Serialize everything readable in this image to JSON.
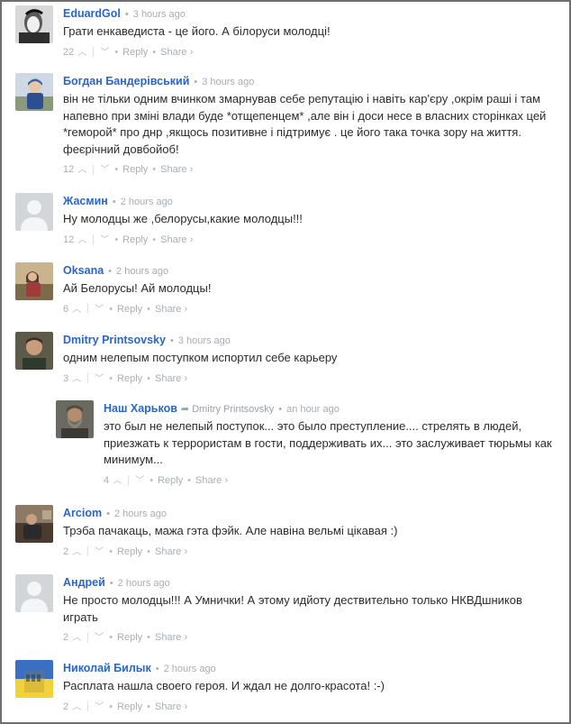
{
  "labels": {
    "reply": "Reply",
    "share": "Share ›",
    "separator": "•"
  },
  "comments": [
    {
      "author": "EduardGol",
      "time": "3 hours ago",
      "text": "Грати енкаведиста - це його. А білоруси молодці!",
      "votes": "22",
      "avatar": "bw-face-icon"
    },
    {
      "author": "Богдан Бандерівський",
      "time": "3 hours ago",
      "text": "він не тільки одним вчинком змарнував себе репутацію і навіть кар'єру ,окрім раші і там напевно при зміні влади буде *отщепенцем* ,але він і доси несе в власних сторінках цей *геморой* про днр ,якщось позитивне і підтримує . це його така точка зору на життя. феєрічний довбойоб!",
      "votes": "12",
      "avatar": "child-photo-icon"
    },
    {
      "author": "Жасмин",
      "time": "2 hours ago",
      "text": "Ну молодцы же ,белорусы,какие молодцы!!!",
      "votes": "12",
      "avatar": "default-user-icon"
    },
    {
      "author": "Oksana",
      "time": "2 hours ago",
      "text": "Ай Белорусы! Ай молодцы!",
      "votes": "6",
      "avatar": "woman-photo-icon"
    },
    {
      "author": "Dmitry Printsovsky",
      "time": "3 hours ago",
      "text": "одним нелепым поступком испортил себе карьеру",
      "votes": "3",
      "avatar": "man-photo-icon"
    },
    {
      "author": "Наш Харьков",
      "reply_to": "Dmitry Printsovsky",
      "time": "an hour ago",
      "text": "это был не нелепый поступок... это было преступление.... стрелять в людей, приезжать к террористам в гости, поддерживать их... это заслуживает тюрьмы как минимум...",
      "votes": "4",
      "avatar": "bearded-man-icon"
    },
    {
      "author": "Arciom",
      "time": "2 hours ago",
      "text": "Трэба пачакаць, мажа гэта фэйк. Але навіна вельмі цікавая :)",
      "votes": "2",
      "avatar": "outdoor-photo-icon"
    },
    {
      "author": "Андрей",
      "time": "2 hours ago",
      "text": "Не просто молодцы!!! А Умнички! А этому идйоту дествительно только НКВДшников играть",
      "votes": "2",
      "avatar": "default-user-icon"
    },
    {
      "author": "Николай Билык",
      "time": "2 hours ago",
      "text": "Расплата нашла своего героя. И ждал не долго-красота! :-)",
      "votes": "2",
      "avatar": "ukraine-fist-icon"
    }
  ]
}
